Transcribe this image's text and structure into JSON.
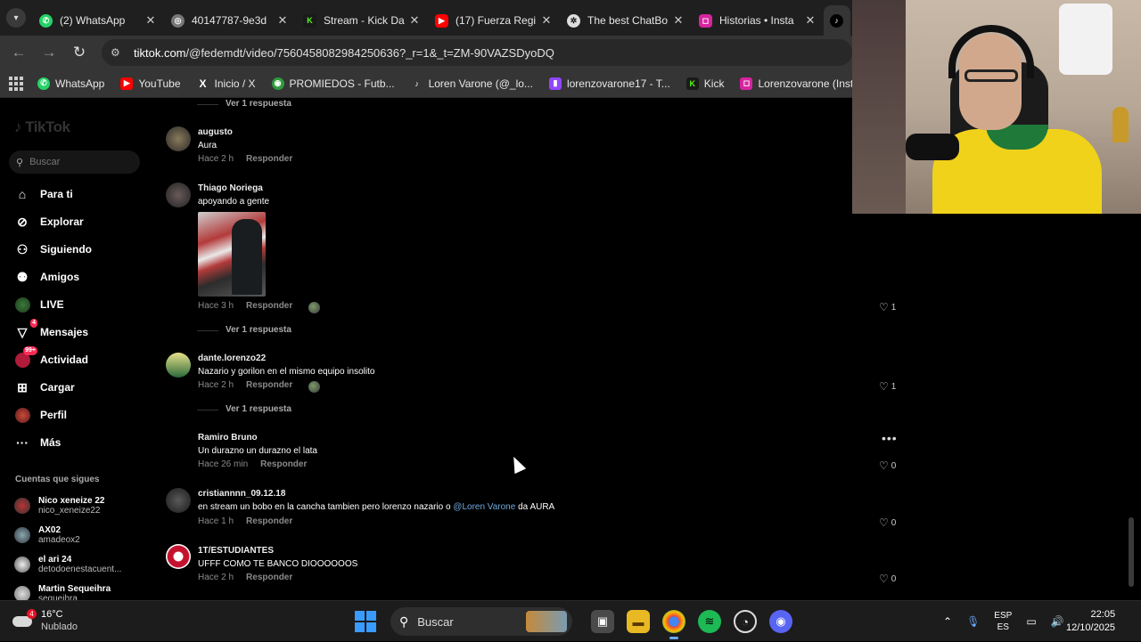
{
  "browser": {
    "tabs": [
      {
        "title": "(2) WhatsApp",
        "icon": "whatsapp-icon",
        "color": "#25d366"
      },
      {
        "title": "40147787-9e3d",
        "icon": "globe-icon",
        "color": "#777777"
      },
      {
        "title": "Stream - Kick Da",
        "icon": "kick-icon",
        "color": "#53fc18"
      },
      {
        "title": "(17) Fuerza Regi",
        "icon": "youtube-icon",
        "color": "#ff0000"
      },
      {
        "title": "The best ChatBo",
        "icon": "chatgpt-icon",
        "color": "#dddddd"
      },
      {
        "title": "Historias • Insta",
        "icon": "instagram-icon",
        "color": "#d6249f"
      }
    ],
    "address": {
      "host": "tiktok.com",
      "path": "/@fedemdt/video/7560458082984250636?_r=1&_t=ZM-90VAZSDyoDQ"
    },
    "bookmarks": [
      {
        "label": "WhatsApp",
        "icon": "whatsapp-icon",
        "color": "#25d366"
      },
      {
        "label": "YouTube",
        "icon": "youtube-icon",
        "color": "#ff0000"
      },
      {
        "label": "Inicio / X",
        "icon": "x-icon",
        "color": "#000000"
      },
      {
        "label": "PROMIEDOS - Futb...",
        "icon": "promiedos-icon",
        "color": "#2e9b3e"
      },
      {
        "label": "Loren Varone (@_lo...",
        "icon": "tiktok-icon",
        "color": "#000000"
      },
      {
        "label": "lorenzovarone17 - T...",
        "icon": "twitch-icon",
        "color": "#9146ff"
      },
      {
        "label": "Kick",
        "icon": "kick-icon",
        "color": "#53fc18"
      },
      {
        "label": "Lorenzovarone (Inst...",
        "icon": "instagram-icon",
        "color": "#d6249f"
      }
    ]
  },
  "sidebar": {
    "logo": "TikTok",
    "search_placeholder": "Buscar",
    "nav": [
      {
        "label": "Para ti",
        "icon": "home-icon"
      },
      {
        "label": "Explorar",
        "icon": "compass-icon"
      },
      {
        "label": "Siguiendo",
        "icon": "following-icon"
      },
      {
        "label": "Amigos",
        "icon": "friends-icon"
      },
      {
        "label": "LIVE",
        "icon": "live-icon"
      },
      {
        "label": "Mensajes",
        "icon": "messages-icon",
        "badge": "4"
      },
      {
        "label": "Actividad",
        "icon": "activity-icon",
        "badge": "99+"
      },
      {
        "label": "Cargar",
        "icon": "upload-icon"
      },
      {
        "label": "Perfil",
        "icon": "profile-icon"
      },
      {
        "label": "Más",
        "icon": "more-icon"
      }
    ],
    "following_header": "Cuentas que sigues",
    "following": [
      {
        "name": "Nico xeneize 22",
        "handle": "nico_xeneize22"
      },
      {
        "name": "AX02",
        "handle": "amadeox2"
      },
      {
        "name": "el ari 24",
        "handle": "detodoenestacuent..."
      },
      {
        "name": "Martin Sequeihra",
        "handle": "sequeihra"
      }
    ]
  },
  "comments": {
    "top_view_more": "Ver 1 respuesta",
    "items": [
      {
        "user": "augusto",
        "text": "Aura",
        "time": "Hace 2 h",
        "reply": "Responder",
        "likes": ""
      },
      {
        "user": "Thiago Noriega",
        "text": "apoyando a gente",
        "time": "Hace 3 h",
        "reply": "Responder",
        "likes": "1",
        "view_more": "Ver 1 respuesta"
      },
      {
        "user": "dante.lorenzo22",
        "text": "Nazario y gorilon en el mismo equipo insolito",
        "time": "Hace 2 h",
        "reply": "Responder",
        "likes": "1",
        "view_more": "Ver 1 respuesta"
      },
      {
        "user": "Ramiro Bruno",
        "text": "Un durazno un durazno el lata",
        "time": "Hace 26 min",
        "reply": "Responder",
        "likes": "0"
      },
      {
        "user": "cristiannnn_09.12.18",
        "text": "en stream un bobo en la cancha tambien pero lorenzo nazario o",
        "mention": "@Loren Varone",
        "text_after": "da AURA",
        "time": "Hace 1 h",
        "reply": "Responder",
        "likes": "0"
      },
      {
        "user": "1T/ESTUDIANTES",
        "text": "UFFF COMO TE BANCO DIOOOOOOS",
        "time": "Hace 2 h",
        "reply": "Responder",
        "likes": "0"
      }
    ]
  },
  "taskbar": {
    "weather": {
      "temp": "16°C",
      "condition": "Nublado",
      "badge": "4"
    },
    "search_label": "Buscar",
    "lang_top": "ESP",
    "lang_bottom": "ES",
    "time": "22:05",
    "date": "12/10/2025"
  }
}
